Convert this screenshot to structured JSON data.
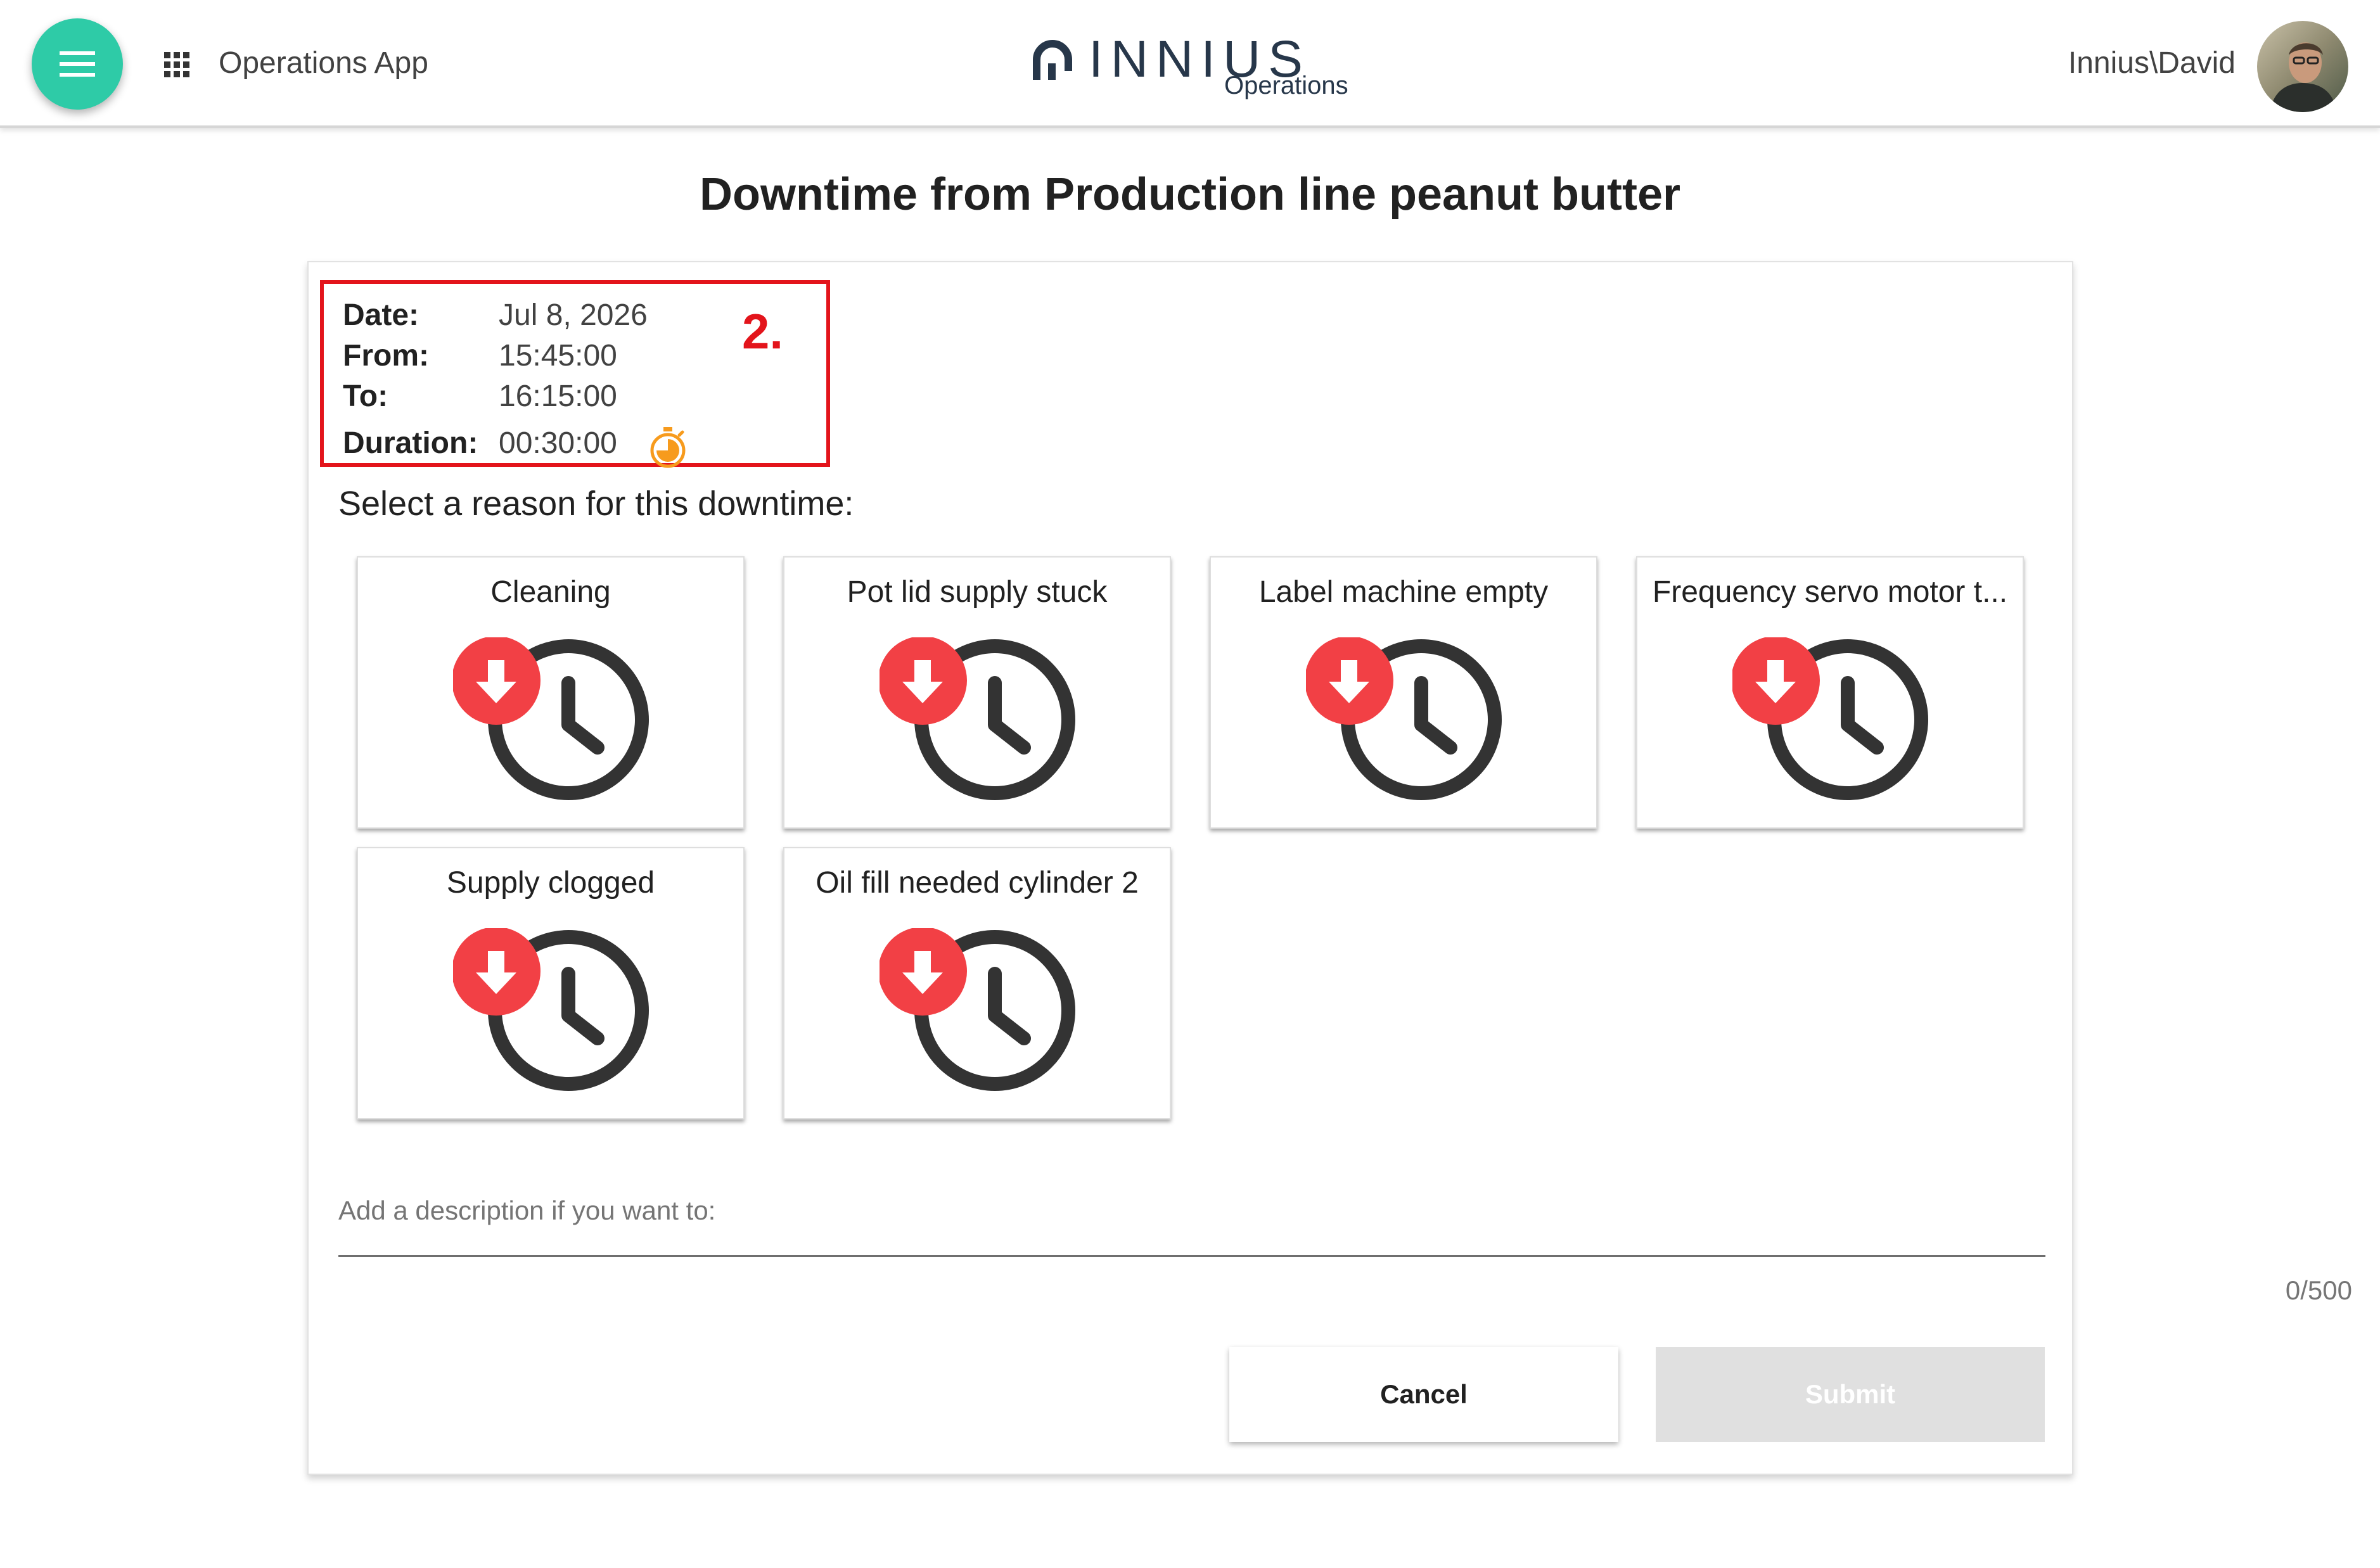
{
  "header": {
    "app_name": "Operations App",
    "logo_text": "INNIUS",
    "logo_subtitle": "Operations",
    "user_name": "Innius\\David",
    "accent_color": "#2ecba7",
    "menu_icon": "hamburger-menu-icon",
    "apps_icon": "apps-grid-icon"
  },
  "page": {
    "title": "Downtime from Production line peanut butter"
  },
  "downtime": {
    "date_label": "Date:",
    "date_value": "Jul 8, 2026",
    "from_label": "From:",
    "from_value": "15:45:00",
    "to_label": "To:",
    "to_value": "16:15:00",
    "duration_label": "Duration:",
    "duration_value": "00:30:00",
    "timer_icon": "stopwatch-icon",
    "timer_color": "#f79b1d",
    "step_marker": "2.",
    "marker_color": "#e3141b"
  },
  "reasons": {
    "prompt": "Select a reason for this downtime:",
    "icon": "downtime-clock-icon",
    "icon_badge_color": "#f24045",
    "items": [
      {
        "label": "Cleaning"
      },
      {
        "label": "Pot lid supply stuck"
      },
      {
        "label": "Label machine empty"
      },
      {
        "label": "Frequency servo motor t..."
      },
      {
        "label": "Supply clogged"
      },
      {
        "label": "Oil fill needed cylinder 2"
      }
    ]
  },
  "description": {
    "placeholder": "Add a description if you want to:",
    "value": "",
    "counter": "0/500"
  },
  "actions": {
    "cancel_label": "Cancel",
    "submit_label": "Submit"
  }
}
